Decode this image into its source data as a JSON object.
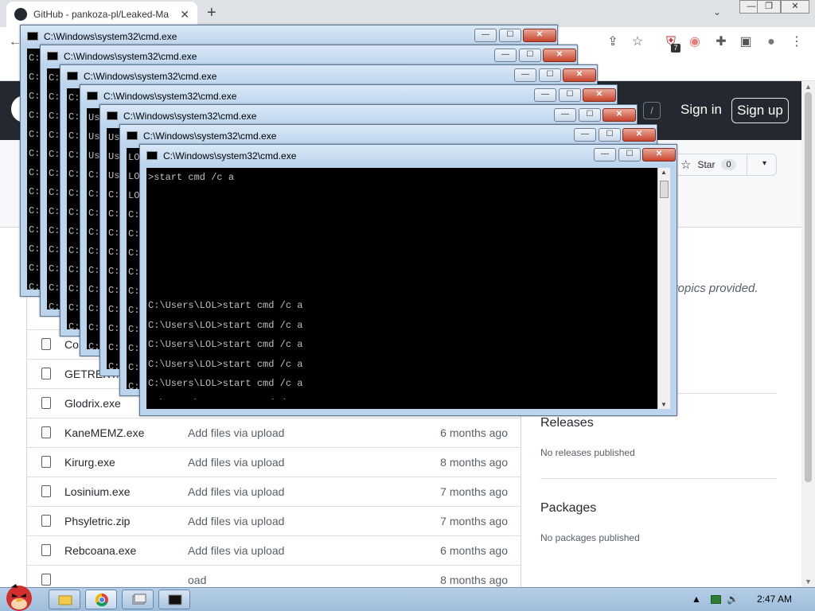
{
  "browser": {
    "tab_title": "GitHub - pankoza-pl/Leaked-Ma",
    "tab_close": "✕",
    "new_tab": "+",
    "tab_list_icon": "chevron-down-icon",
    "win_minimize": "—",
    "win_restore": "❐",
    "win_close": "✕",
    "toolbar_glyphs": {
      "back": "←",
      "share": "⇪",
      "bookmark_star": "☆",
      "extension_badge": "7",
      "extensions": "✚",
      "side_panel": "▣",
      "profile": "●",
      "menu": "⋮"
    }
  },
  "github": {
    "slash_key": "/",
    "sign_in": "Sign in",
    "sign_up": "Sign up",
    "star_label": "Star",
    "star_count": "0",
    "star_glyph": "☆",
    "caret_glyph": "▾",
    "about_text": "or topics provided.",
    "files": [
      {
        "name": "Co",
        "message": "",
        "age": ""
      },
      {
        "name": "GETREKT.zi",
        "message": "",
        "age": ""
      },
      {
        "name": "Glodrix.exe",
        "message": "",
        "age": ""
      },
      {
        "name": "KaneMEMZ.exe",
        "message": "Add files via upload",
        "age": "6 months ago"
      },
      {
        "name": "Kirurg.exe",
        "message": "Add files via upload",
        "age": "8 months ago"
      },
      {
        "name": "Losinium.exe",
        "message": "Add files via upload",
        "age": "7 months ago"
      },
      {
        "name": "Phsyletric.zip",
        "message": "Add files via upload",
        "age": "7 months ago"
      },
      {
        "name": "Rebcoana.exe",
        "message": "Add files via upload",
        "age": "6 months ago"
      },
      {
        "name": "",
        "message": "oad",
        "age": "8 months ago"
      }
    ],
    "releases_heading": "Releases",
    "releases_text": "No releases published",
    "packages_heading": "Packages",
    "packages_text": "No packages published"
  },
  "cmd": {
    "title": "C:\\Windows\\system32\\cmd.exe",
    "btn_min": "—",
    "btn_max": "☐",
    "btn_close": "✕",
    "scroll_up": "▲",
    "scroll_down": "▼",
    "windows": [
      {
        "lines": [
          "C:",
          "C:",
          "C:",
          "C:",
          "C:",
          "C:",
          "C:",
          "C:",
          "C:",
          "C:",
          "C:",
          "C:",
          "C:"
        ]
      },
      {
        "lines": [
          "C:",
          "C:",
          "C:",
          "C:",
          "C:",
          "C:",
          "C:",
          "C:",
          "C:",
          "C:",
          "C:",
          "C:",
          "C:"
        ]
      },
      {
        "lines": [
          "C:",
          "C:",
          "C:",
          "C:",
          "C:",
          "C:",
          "C:",
          "C:",
          "C:",
          "C:",
          "C:",
          "C:",
          "C:"
        ]
      },
      {
        "lines": [
          "Us",
          "Us",
          "Us",
          "C:",
          "C:",
          "C:",
          "C:",
          "C:",
          "C:",
          "C:",
          "C:",
          "C:",
          "C:"
        ]
      },
      {
        "lines": [
          "Us",
          "Us",
          "Us",
          "C:",
          "C:",
          "C:",
          "C:",
          "C:",
          "C:",
          "C:",
          "C:",
          "C:",
          "C:"
        ]
      },
      {
        "lines": [
          "LOL",
          "LOL",
          "LOL",
          "C:",
          "C:",
          "C:",
          "C:",
          "C:",
          "C:",
          "C:",
          "C:",
          "C:",
          "C:"
        ]
      },
      {
        "lines": [
          ">start cmd /c a"
        ]
      }
    ],
    "behind_lines": [
      "C:\\Users\\LOL>start cmd /c a",
      "C:\\Users\\LOL>start cmd /c a",
      "C:\\Users\\LOL>start cmd /c a",
      "C:\\Users\\LOL>start cmd /c a",
      "C:\\Users\\LOL>start cmd /c a",
      "C:\\Users\\LOL>start cmd /c a"
    ]
  },
  "taskbar": {
    "start_icon": "angry-bird-icon",
    "tray_arrow": "▲",
    "tray_volume": "🔊",
    "clock": "2:47 AM"
  }
}
